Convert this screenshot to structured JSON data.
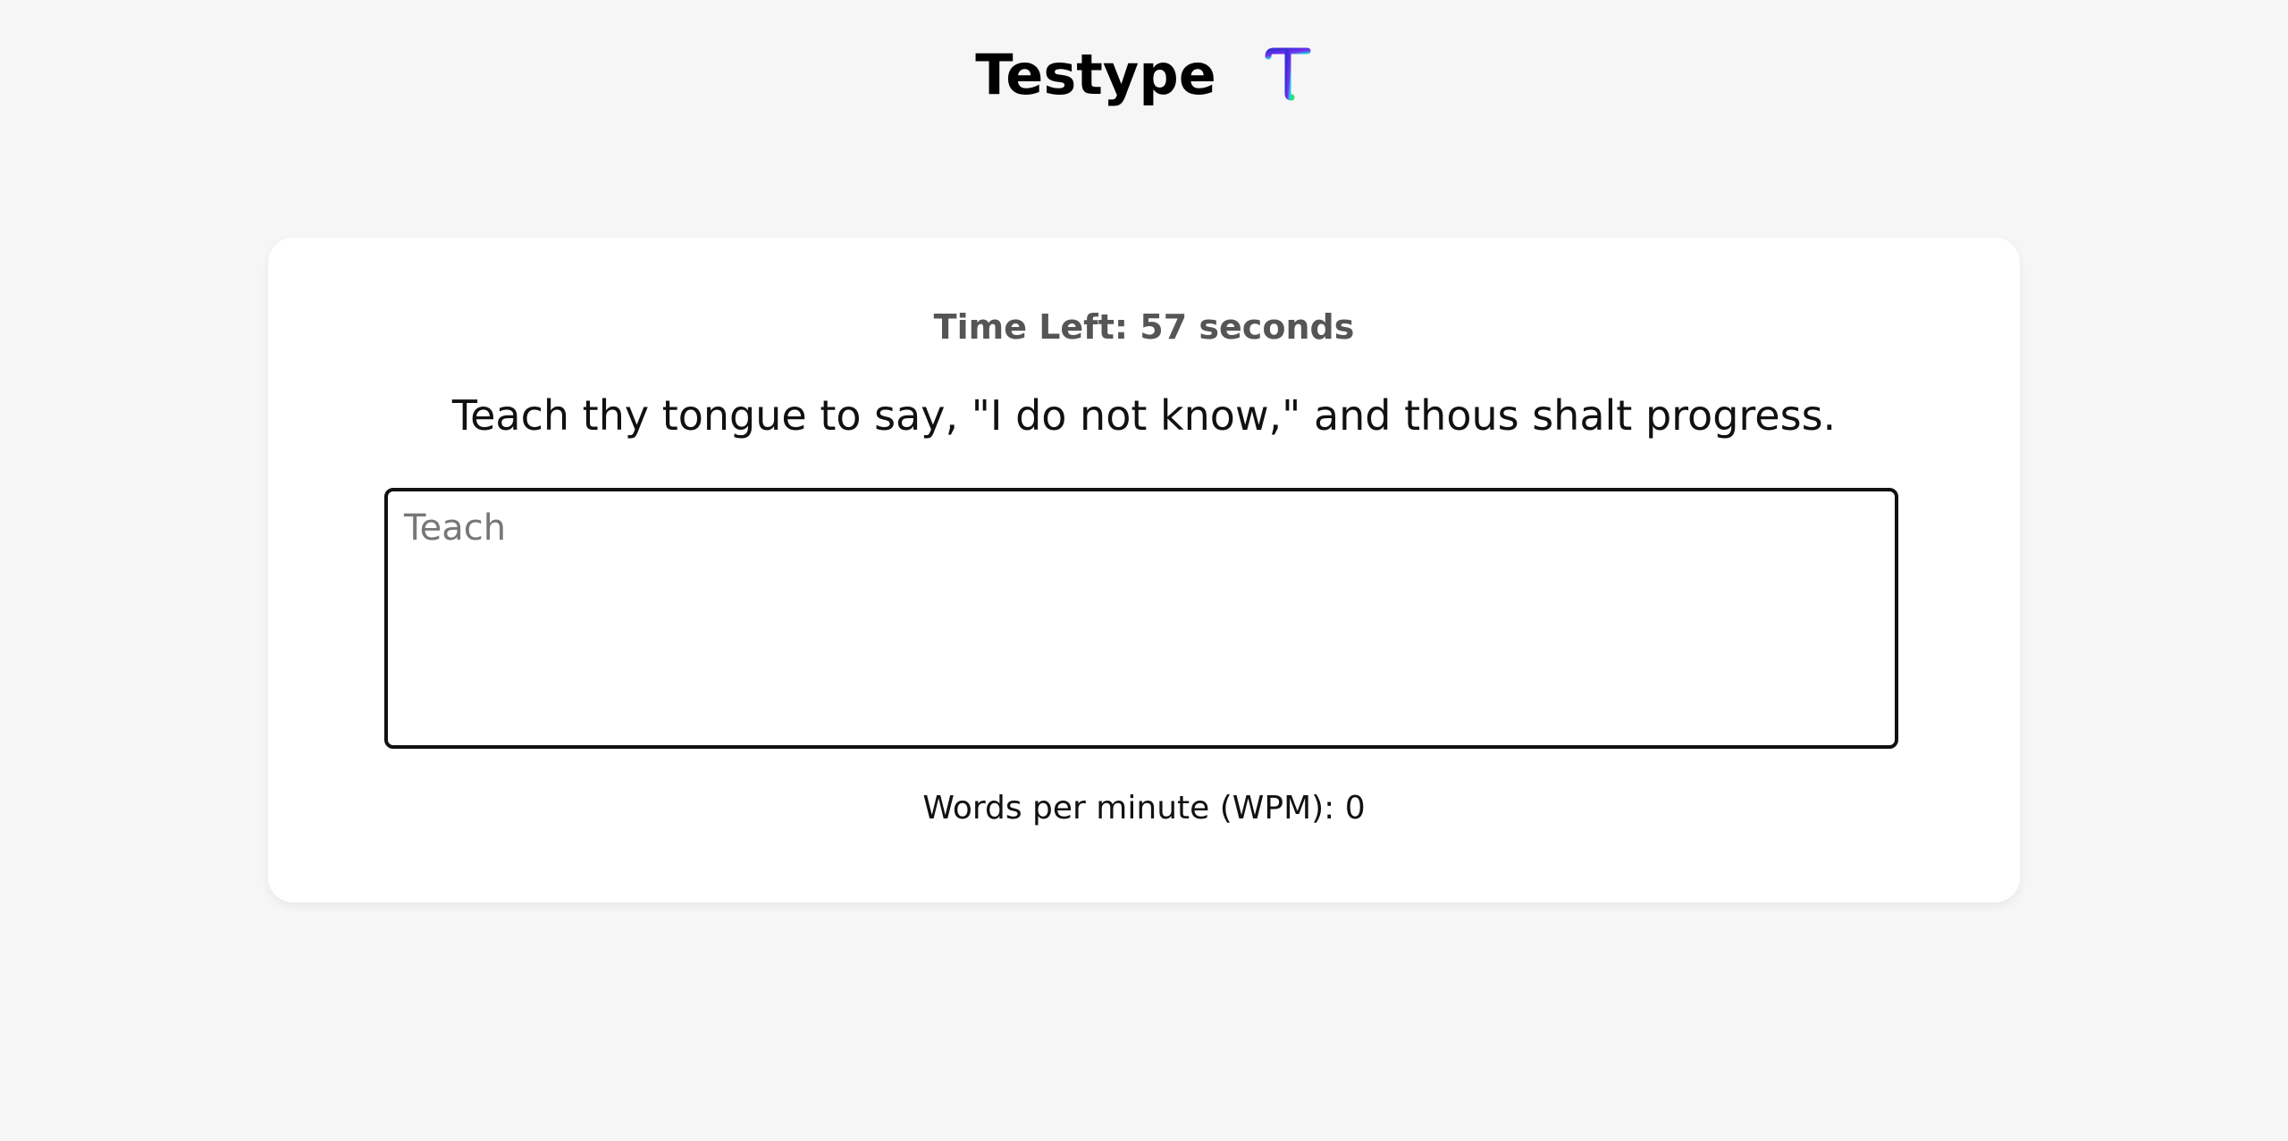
{
  "header": {
    "title": "Testype",
    "logo_icon": "t-gradient-logo-icon"
  },
  "test": {
    "timer_text": "Time Left: 57 seconds",
    "quote": "Teach thy tongue to say, \"I do not know,\" and thous shalt progress.",
    "input_value": "Teach",
    "wpm_text": "Words per minute (WPM): 0"
  },
  "colors": {
    "background": "#f6f6f6",
    "card": "#ffffff",
    "timer": "#555555",
    "logo_gradient": [
      "#3b2fd8",
      "#7a2ff0",
      "#1fc4e8",
      "#27e07a"
    ]
  }
}
